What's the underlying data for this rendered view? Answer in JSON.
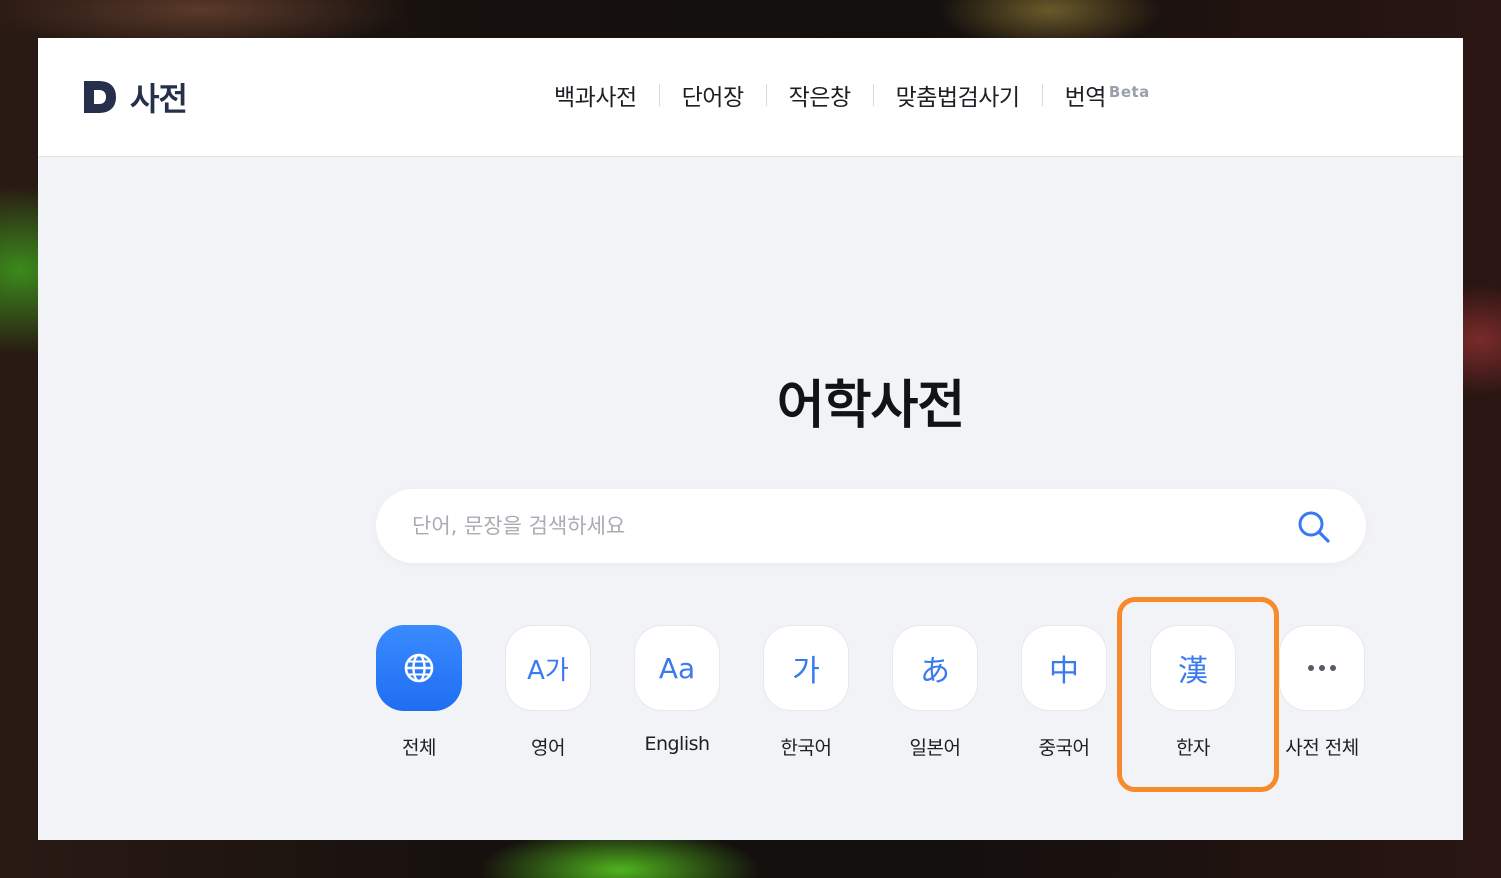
{
  "brand": {
    "name": "사전",
    "letter": "D"
  },
  "nav": {
    "items": [
      {
        "label": "백과사전"
      },
      {
        "label": "단어장"
      },
      {
        "label": "작은창"
      },
      {
        "label": "맞춤법검사기"
      },
      {
        "label": "번역",
        "badge": "Beta"
      }
    ]
  },
  "main": {
    "title": "어학사전",
    "search": {
      "placeholder": "단어, 문장을 검색하세요",
      "value": ""
    },
    "categories": [
      {
        "label": "전체",
        "icon": "globe-icon",
        "active": true
      },
      {
        "label": "영어",
        "icon_text": "A가"
      },
      {
        "label": "English",
        "icon_text": "Aa"
      },
      {
        "label": "한국어",
        "icon_text": "가"
      },
      {
        "label": "일본어",
        "icon_text": "あ"
      },
      {
        "label": "중국어",
        "icon_text": "中"
      },
      {
        "label": "한자",
        "icon_text": "漢"
      },
      {
        "label": "사전 전체",
        "icon": "more-icon"
      }
    ]
  },
  "colors": {
    "accent": "#2f7cf6",
    "highlight": "#f78a2a",
    "brand": "#27304a"
  }
}
